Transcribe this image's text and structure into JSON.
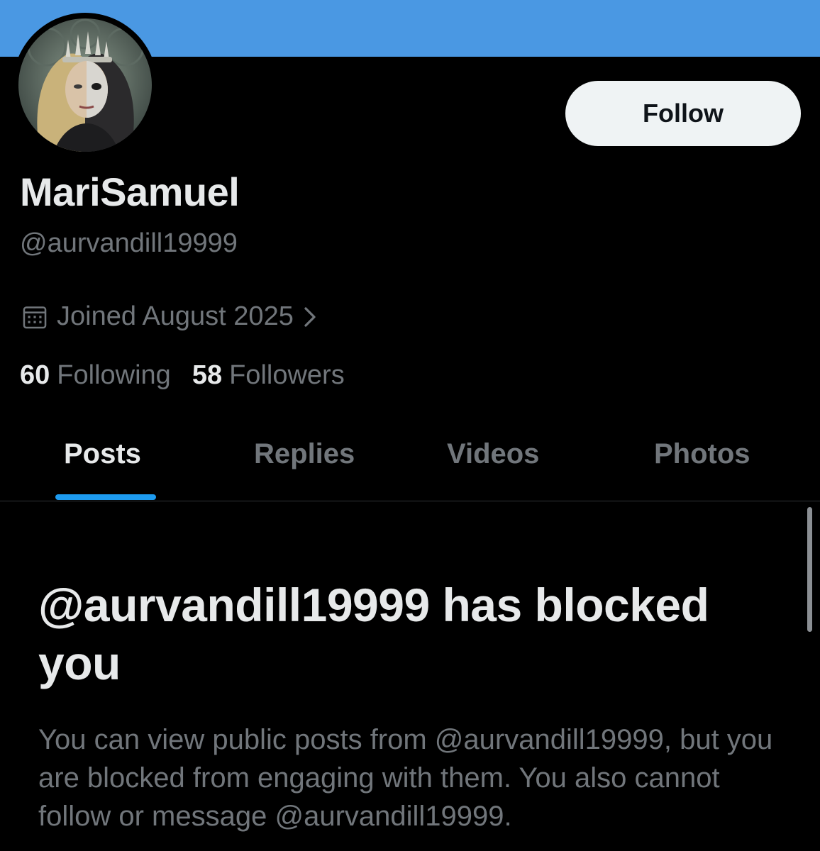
{
  "colors": {
    "banner": "#4a98e3",
    "background": "#000000",
    "accent": "#1d9bf0",
    "text_primary": "#e7e9ea",
    "text_secondary": "#71767b",
    "button_bg": "#eff3f4"
  },
  "profile": {
    "display_name": "MariSamuel",
    "handle": "@aurvandill19999",
    "joined": "Joined August 2025",
    "avatar_icon": "profile-avatar-portrait",
    "following_count": "60",
    "following_label": "Following",
    "followers_count": "58",
    "followers_label": "Followers"
  },
  "actions": {
    "follow_label": "Follow"
  },
  "tabs": [
    {
      "label": "Posts",
      "active": true
    },
    {
      "label": "Replies",
      "active": false
    },
    {
      "label": "Videos",
      "active": false
    },
    {
      "label": "Photos",
      "active": false
    }
  ],
  "blocked": {
    "title": "@aurvandill19999 has blocked you",
    "message": "You can view public posts from @aurvandill19999, but you are blocked from engaging with them. You also cannot follow or message @aurvandill19999."
  }
}
